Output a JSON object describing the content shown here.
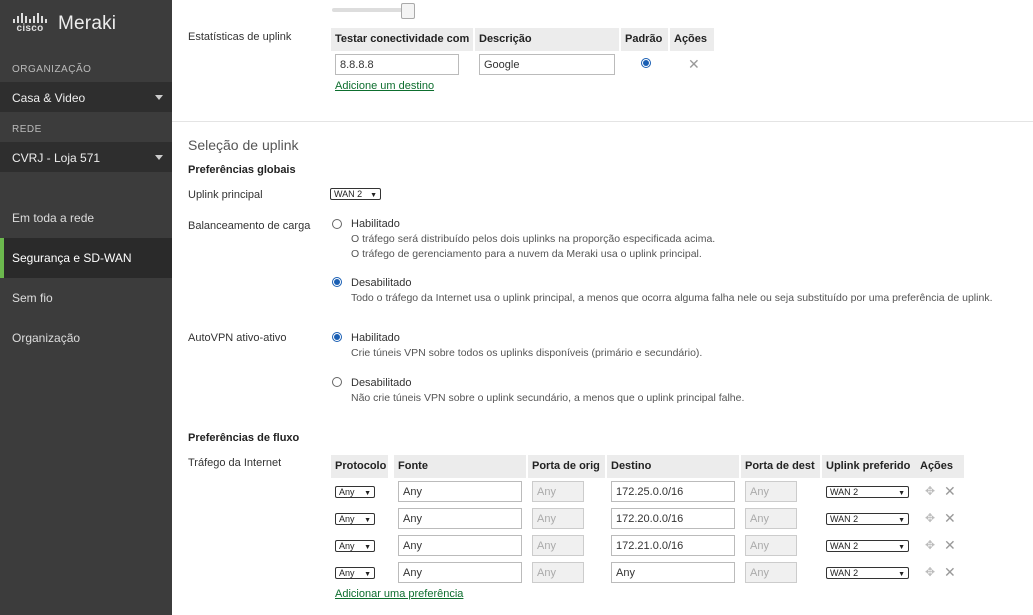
{
  "sidebar": {
    "brand": {
      "cisco": "cisco",
      "meraki": "Meraki"
    },
    "org_label": "ORGANIZAÇÃO",
    "org_value": "Casa & Video",
    "net_label": "REDE",
    "net_value": "CVRJ - Loja 571",
    "nav": [
      {
        "label": "Em toda a rede"
      },
      {
        "label": "Segurança e SD-WAN"
      },
      {
        "label": "Sem fio"
      },
      {
        "label": "Organização"
      }
    ]
  },
  "uplink_stats": {
    "label": "Estatísticas de uplink",
    "headers": [
      "Testar conectividade com",
      "Descrição",
      "Padrão",
      "Ações"
    ],
    "row": {
      "target": "8.8.8.8",
      "description": "Google"
    },
    "add_link": "Adicione um destino"
  },
  "uplink_selection": {
    "title": "Seleção de uplink",
    "global_prefs": "Preferências globais",
    "primary_label": "Uplink principal",
    "primary_value": "WAN 2",
    "load_balancing_label": "Balanceamento de carga",
    "lb_enabled": {
      "label": "Habilitado",
      "desc1": "O tráfego será distribuído pelos dois uplinks na proporção especificada acima.",
      "desc2": "O tráfego de gerenciamento para a nuvem da Meraki usa o uplink principal."
    },
    "lb_disabled": {
      "label": "Desabilitado",
      "desc": "Todo o tráfego da Internet usa o uplink principal, a menos que ocorra alguma falha nele ou seja substituído por uma preferência de uplink."
    },
    "autovpn_label": "AutoVPN ativo-ativo",
    "vpn_enabled": {
      "label": "Habilitado",
      "desc": "Crie túneis VPN sobre todos os uplinks disponíveis (primário e secundário)."
    },
    "vpn_disabled": {
      "label": "Desabilitado",
      "desc": "Não crie túneis VPN sobre o uplink secundário, a menos que o uplink principal falhe."
    }
  },
  "flow_prefs": {
    "title": "Preferências de fluxo",
    "internet_label": "Tráfego da Internet",
    "headers": [
      "Protocolo",
      "Fonte",
      "Porta de orig",
      "Destino",
      "Porta de dest",
      "Uplink preferido",
      "Ações"
    ],
    "rows": [
      {
        "protocol": "Any",
        "source": "Any",
        "src_port": "Any",
        "dest": "172.25.0.0/16",
        "dest_port": "Any",
        "uplink": "WAN 2"
      },
      {
        "protocol": "Any",
        "source": "Any",
        "src_port": "Any",
        "dest": "172.20.0.0/16",
        "dest_port": "Any",
        "uplink": "WAN 2"
      },
      {
        "protocol": "Any",
        "source": "Any",
        "src_port": "Any",
        "dest": "172.21.0.0/16",
        "dest_port": "Any",
        "uplink": "WAN 2"
      },
      {
        "protocol": "Any",
        "source": "Any",
        "src_port": "Any",
        "dest": "Any",
        "dest_port": "Any",
        "uplink": "WAN 2"
      }
    ],
    "add_link": "Adicionar uma preferência"
  },
  "colors": {
    "sidebar_bg": "#3c3c3c",
    "active_accent": "#6bb84d",
    "link": "#0d6e2e",
    "radio": "#1a5fb4"
  }
}
